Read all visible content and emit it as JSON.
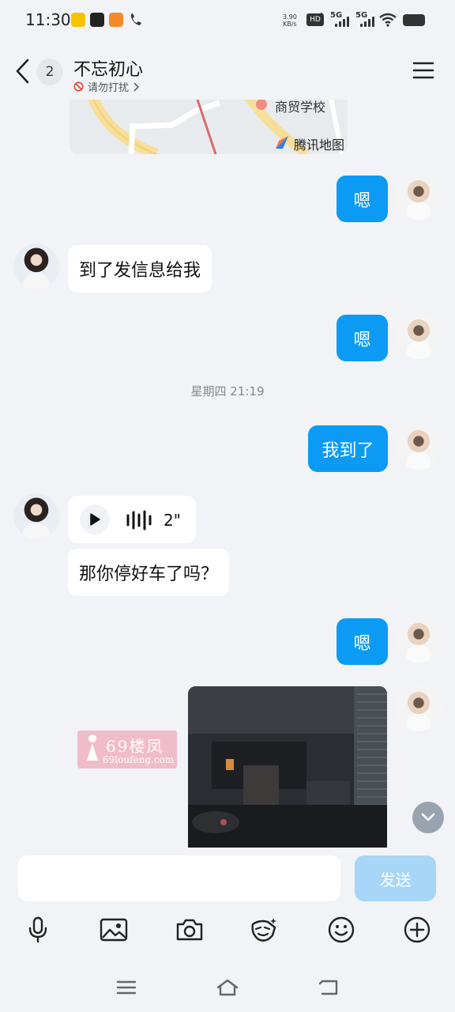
{
  "status_bar": {
    "time": "11:30",
    "net_speed_value": "3.90",
    "net_speed_unit": "KB/s",
    "hd": "HD",
    "sim1": "1",
    "sim2": "2",
    "network1": "5G",
    "network2": "5G"
  },
  "header": {
    "unread_count": "2",
    "contact_name": "不忘初心",
    "dnd_status": "请勿打扰"
  },
  "map": {
    "poi_label": "商贸学校",
    "provider_label": "腾讯地图"
  },
  "messages": {
    "m1": "嗯",
    "m2": "到了发信息给我",
    "m3": "嗯",
    "timestamp": "星期四 21:19",
    "m4": "我到了",
    "voice_duration": "2\"",
    "m5": "那你停好车了吗？",
    "m6": "嗯"
  },
  "watermark": {
    "line1": "69楼凤",
    "line2": "69loufeng.com"
  },
  "input": {
    "placeholder": "",
    "send_label": "发送"
  },
  "colors": {
    "my_bubble": "#0b9bf5",
    "send_disabled": "#a7d6f8",
    "background": "#f2f3f7"
  }
}
